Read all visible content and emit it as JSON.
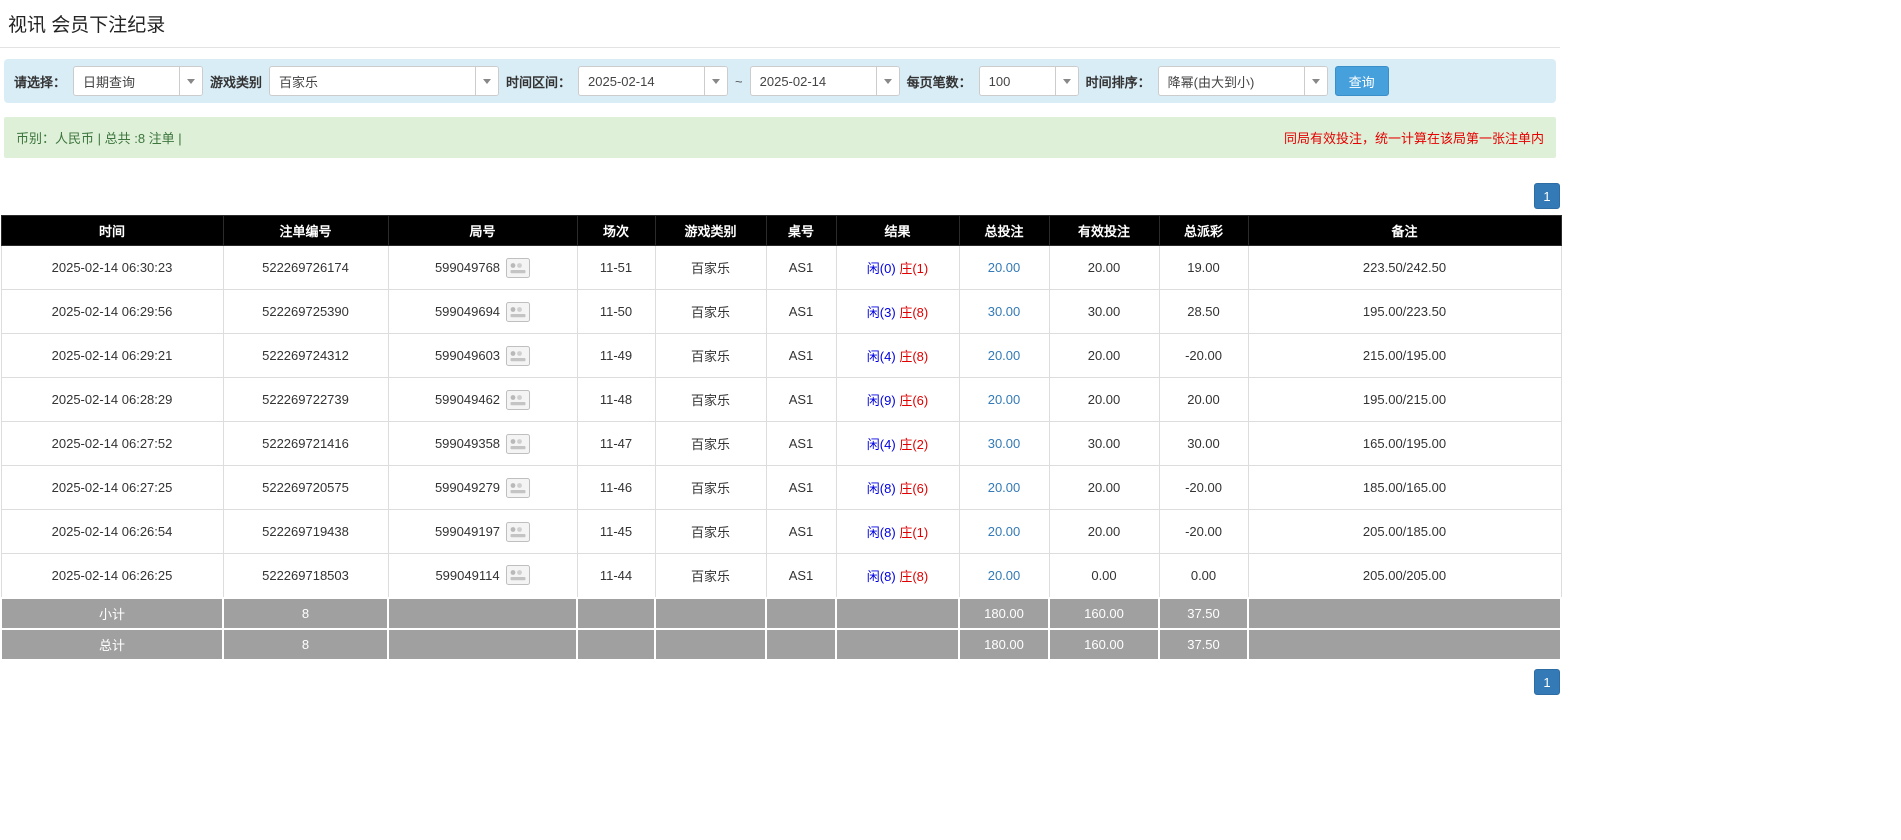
{
  "page": {
    "title": "视讯 会员下注纪录"
  },
  "filters": {
    "select_label": "请选择：",
    "query_type": "日期查询",
    "game_type_label": "游戏类别",
    "game_type": "百家乐",
    "time_range_label": "时间区间：",
    "date_from": "2025-02-14",
    "tilde": "~",
    "date_to": "2025-02-14",
    "per_page_label": "每页笔数：",
    "per_page": "100",
    "sort_label": "时间排序：",
    "sort_order": "降幂(由大到小)",
    "search_button": "查询"
  },
  "summary_bar": {
    "left_text": "币别：人民币 | 总共 :8 注单 |",
    "right_text": "同局有效投注，统一计算在该局第一张注单内"
  },
  "pagination": {
    "page": "1"
  },
  "table": {
    "headers": [
      "时间",
      "注单编号",
      "局号",
      "场次",
      "游戏类别",
      "桌号",
      "结果",
      "总投注",
      "有效投注",
      "总派彩",
      "备注"
    ],
    "rows": [
      {
        "time": "2025-02-14 06:30:23",
        "bet_id": "522269726174",
        "round_id": "599049768",
        "session": "11-51",
        "game": "百家乐",
        "table_no": "AS1",
        "result": {
          "player": "闲(0)",
          "banker": "庄(1)"
        },
        "total_bet": "20.00",
        "valid_bet": "20.00",
        "payout": "19.00",
        "remark": "223.50/242.50"
      },
      {
        "time": "2025-02-14 06:29:56",
        "bet_id": "522269725390",
        "round_id": "599049694",
        "session": "11-50",
        "game": "百家乐",
        "table_no": "AS1",
        "result": {
          "player": "闲(3)",
          "banker": "庄(8)"
        },
        "total_bet": "30.00",
        "valid_bet": "30.00",
        "payout": "28.50",
        "remark": "195.00/223.50"
      },
      {
        "time": "2025-02-14 06:29:21",
        "bet_id": "522269724312",
        "round_id": "599049603",
        "session": "11-49",
        "game": "百家乐",
        "table_no": "AS1",
        "result": {
          "player": "闲(4)",
          "banker": "庄(8)"
        },
        "total_bet": "20.00",
        "valid_bet": "20.00",
        "payout": "-20.00",
        "remark": "215.00/195.00"
      },
      {
        "time": "2025-02-14 06:28:29",
        "bet_id": "522269722739",
        "round_id": "599049462",
        "session": "11-48",
        "game": "百家乐",
        "table_no": "AS1",
        "result": {
          "player": "闲(9)",
          "banker": "庄(6)"
        },
        "total_bet": "20.00",
        "valid_bet": "20.00",
        "payout": "20.00",
        "remark": "195.00/215.00"
      },
      {
        "time": "2025-02-14 06:27:52",
        "bet_id": "522269721416",
        "round_id": "599049358",
        "session": "11-47",
        "game": "百家乐",
        "table_no": "AS1",
        "result": {
          "player": "闲(4)",
          "banker": "庄(2)"
        },
        "total_bet": "30.00",
        "valid_bet": "30.00",
        "payout": "30.00",
        "remark": "165.00/195.00"
      },
      {
        "time": "2025-02-14 06:27:25",
        "bet_id": "522269720575",
        "round_id": "599049279",
        "session": "11-46",
        "game": "百家乐",
        "table_no": "AS1",
        "result": {
          "player": "闲(8)",
          "banker": "庄(6)"
        },
        "total_bet": "20.00",
        "valid_bet": "20.00",
        "payout": "-20.00",
        "remark": "185.00/165.00"
      },
      {
        "time": "2025-02-14 06:26:54",
        "bet_id": "522269719438",
        "round_id": "599049197",
        "session": "11-45",
        "game": "百家乐",
        "table_no": "AS1",
        "result": {
          "player": "闲(8)",
          "banker": "庄(1)"
        },
        "total_bet": "20.00",
        "valid_bet": "20.00",
        "payout": "-20.00",
        "remark": "205.00/185.00"
      },
      {
        "time": "2025-02-14 06:26:25",
        "bet_id": "522269718503",
        "round_id": "599049114",
        "session": "11-44",
        "game": "百家乐",
        "table_no": "AS1",
        "result": {
          "player": "闲(8)",
          "banker": "庄(8)"
        },
        "total_bet": "20.00",
        "valid_bet": "0.00",
        "payout": "0.00",
        "remark": "205.00/205.00"
      }
    ],
    "subtotal": {
      "label": "小计",
      "count": "8",
      "total_bet": "180.00",
      "valid_bet": "160.00",
      "payout": "37.50"
    },
    "total": {
      "label": "总计",
      "count": "8",
      "total_bet": "180.00",
      "valid_bet": "160.00",
      "payout": "37.50"
    }
  },
  "colors": {
    "filter_bar_bg": "#d9edf7",
    "summary_bar_bg": "#dff0d8",
    "summary_text_green": "#3c763d",
    "notice_red": "#e60000",
    "table_header_bg": "#000000",
    "table_footer_bg": "#a0a0a0",
    "player_blue": "#0000e0",
    "banker_red": "#e00000",
    "bet_link_blue": "#337ab7",
    "negative_red": "#ff0000",
    "search_button_bg": "#46a0dc",
    "pagination_bg": "#337ab7"
  }
}
